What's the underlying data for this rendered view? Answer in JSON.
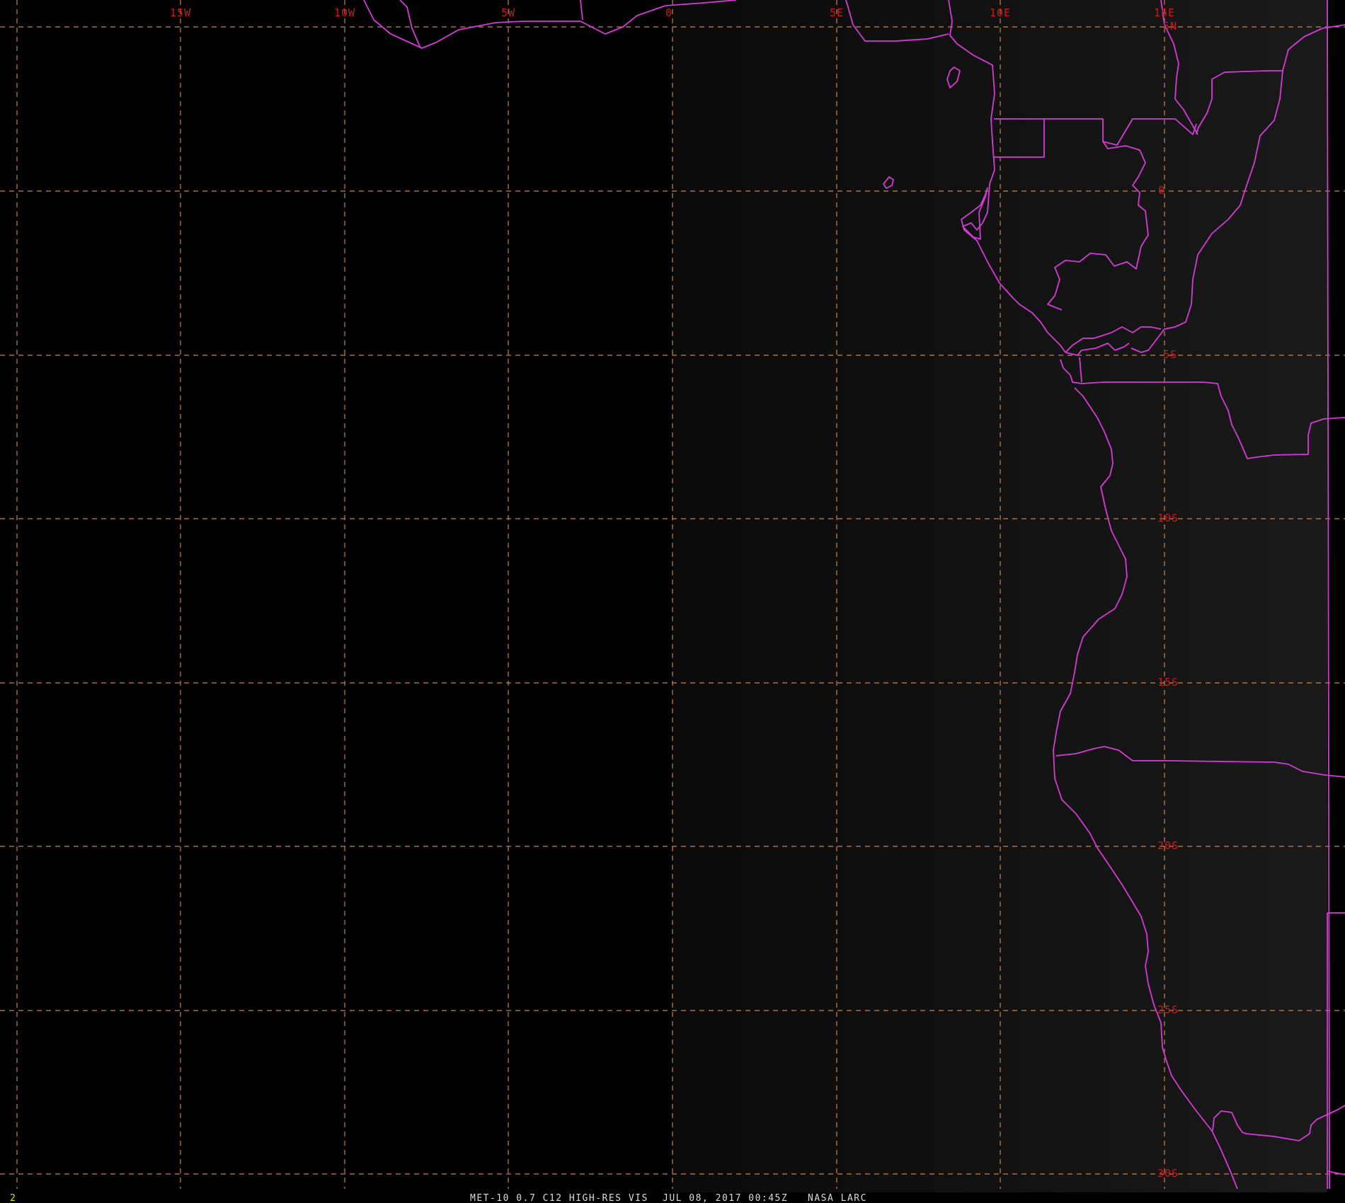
{
  "map": {
    "colors": {
      "background_ocean": "#000000",
      "background_dim": "#141414",
      "grid": "#c8844a",
      "labels": "#d01818",
      "borders": "#d63ad6",
      "frame_number": "#e3e300",
      "footer_text": "#dcdcdc"
    },
    "longitude_labels": [
      "15W",
      "10W",
      "5W",
      "0",
      "5E",
      "10E",
      "15E"
    ],
    "latitude_labels": [
      "5N",
      "0",
      "5S",
      "10S",
      "15S",
      "20S",
      "25S",
      "30S"
    ]
  },
  "footer": {
    "frame_number": "2",
    "product": "MET-10 0.7 C12 HIGH-RES VIS",
    "timestamp": "JUL 08, 2017 00:45Z",
    "source": "NASA LARC"
  }
}
